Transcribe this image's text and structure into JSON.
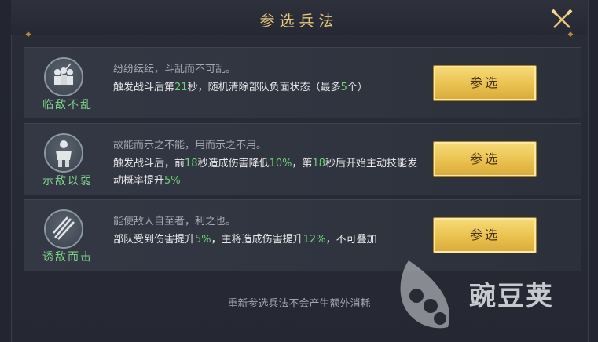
{
  "dialog": {
    "title": "参选兵法",
    "close_icon": "close-icon",
    "accent": "#e6c57f"
  },
  "tactics": [
    {
      "name": "临敌不乱",
      "icon": "soldiers-group-icon",
      "flavor": "纷纷纭纭，斗乱而不可乱。",
      "desc": [
        {
          "t": "触发战斗后第",
          "g": false
        },
        {
          "t": "21",
          "g": true
        },
        {
          "t": "秒，随机清除部队负面状态（最多",
          "g": false
        },
        {
          "t": "5",
          "g": true
        },
        {
          "t": "个）",
          "g": false
        }
      ],
      "button": "参选"
    },
    {
      "name": "示敌以弱",
      "icon": "armored-soldier-icon",
      "flavor": "故能而示之不能，用而示之不用。",
      "desc": [
        {
          "t": "触发战斗后，前",
          "g": false
        },
        {
          "t": "18",
          "g": true
        },
        {
          "t": "秒造成伤害降低",
          "g": false
        },
        {
          "t": "10%",
          "g": true
        },
        {
          "t": "，第",
          "g": false
        },
        {
          "t": "18",
          "g": true
        },
        {
          "t": "秒后开始主动技能发动概率提升",
          "g": false
        },
        {
          "t": "5%",
          "g": true
        }
      ],
      "button": "参选"
    },
    {
      "name": "诱敌而击",
      "icon": "arrow-volley-icon",
      "flavor": "能使敌人自至者，利之也。",
      "desc": [
        {
          "t": "部队受到伤害提升",
          "g": false
        },
        {
          "t": "5%",
          "g": true
        },
        {
          "t": "，主将造成伤害提升",
          "g": false
        },
        {
          "t": "12%",
          "g": true
        },
        {
          "t": "，不可叠加",
          "g": false
        }
      ],
      "button": "参选"
    }
  ],
  "footer": "重新参选兵法不会产生额外消耗",
  "watermark": "豌豆荚",
  "colors": {
    "highlight_green": "#6fd078",
    "button_gold": "#e9c14f",
    "name_green": "#7fd08a"
  }
}
